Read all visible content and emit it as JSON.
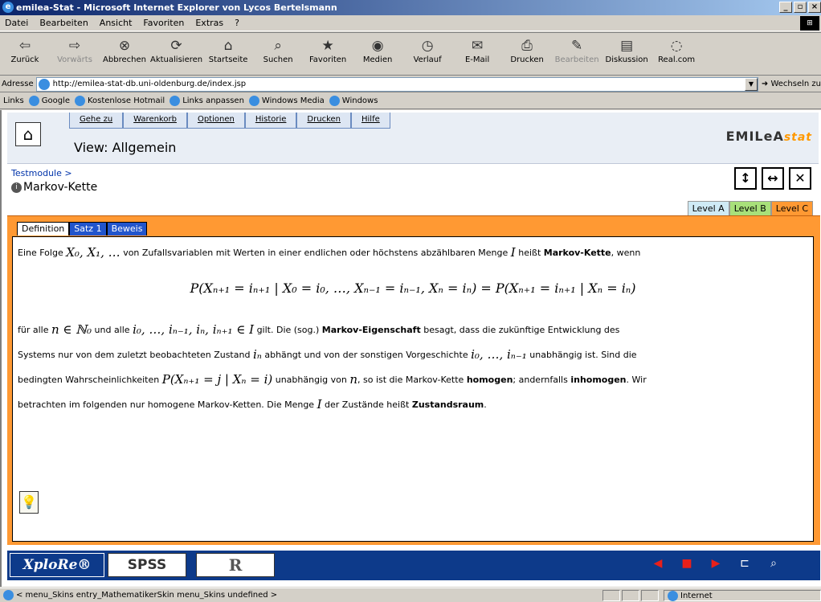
{
  "window": {
    "title": "emilea-Stat - Microsoft Internet Explorer von Lycos Bertelsmann"
  },
  "menu": [
    "Datei",
    "Bearbeiten",
    "Ansicht",
    "Favoriten",
    "Extras",
    "?"
  ],
  "toolbar": [
    {
      "label": "Zurück",
      "icon": "back-arrow-icon"
    },
    {
      "label": "Vorwärts",
      "icon": "forward-arrow-icon"
    },
    {
      "label": "Abbrechen",
      "icon": "stop-icon"
    },
    {
      "label": "Aktualisieren",
      "icon": "refresh-icon"
    },
    {
      "label": "Startseite",
      "icon": "home-icon"
    },
    {
      "label": "Suchen",
      "icon": "search-icon"
    },
    {
      "label": "Favoriten",
      "icon": "favorites-icon"
    },
    {
      "label": "Medien",
      "icon": "media-icon"
    },
    {
      "label": "Verlauf",
      "icon": "history-icon"
    },
    {
      "label": "E-Mail",
      "icon": "mail-icon"
    },
    {
      "label": "Drucken",
      "icon": "print-icon"
    },
    {
      "label": "Bearbeiten",
      "icon": "edit-icon"
    },
    {
      "label": "Diskussion",
      "icon": "discussion-icon"
    },
    {
      "label": "Real.com",
      "icon": "realcom-icon"
    }
  ],
  "address": {
    "label": "Adresse",
    "url": "http://emilea-stat-db.uni-oldenburg.de/index.jsp",
    "go": "Wechseln zu"
  },
  "links": {
    "label": "Links",
    "items": [
      "Google",
      "Kostenlose Hotmail",
      "Links anpassen",
      "Windows Media",
      "Windows"
    ]
  },
  "page": {
    "nav": [
      "Gehe zu",
      "Warenkorb",
      "Optionen",
      "Historie",
      "Drucken",
      "Hilfe"
    ],
    "view_title": "View: Allgemein",
    "brand": "EMILeA",
    "brand_suffix": "stat",
    "breadcrumb": "Testmodule >",
    "module_title": "Markov-Kette",
    "levels": [
      "Level A",
      "Level B",
      "Level C"
    ],
    "tabs": [
      "Definition",
      "Satz 1",
      "Beweis"
    ],
    "definition": {
      "p1_a": "Eine Folge",
      "p1_m1": "X₀, X₁, …",
      "p1_b": "von Zufallsvariablen mit Werten in einer endlichen oder höchstens abzählbaren Menge",
      "p1_m2": "I",
      "p1_c": "heißt",
      "p1_bold": "Markov-Kette",
      "p1_d": ", wenn",
      "formula": "P(Xₙ₊₁ = iₙ₊₁ | X₀ = i₀, …, Xₙ₋₁ = iₙ₋₁, Xₙ = iₙ) = P(Xₙ₊₁ = iₙ₊₁ | Xₙ = iₙ)",
      "l1_a": "für alle",
      "l1_m1": "n ∈ ℕ₀",
      "l1_b": "und alle",
      "l1_m2": "i₀, …, iₙ₋₁, iₙ, iₙ₊₁ ∈ I",
      "l1_c": "gilt. Die (sog.)",
      "l1_bold": "Markov-Eigenschaft",
      "l1_d": "besagt, dass die zukünftige Entwicklung des",
      "l2_a": "Systems nur von dem zuletzt beobachteten Zustand",
      "l2_m1": "iₙ",
      "l2_b": "abhängt und von der sonstigen Vorgeschichte",
      "l2_m2": "i₀, …, iₙ₋₁",
      "l2_c": "unabhängig ist. Sind die",
      "l3_a": "bedingten Wahrscheinlichkeiten",
      "l3_m1": "P(Xₙ₊₁ = j | Xₙ = i)",
      "l3_b": "unabhängig von",
      "l3_m2": "n",
      "l3_c": ", so ist die Markov-Kette",
      "l3_bold1": "homogen",
      "l3_d": "; andernfalls",
      "l3_bold2": "inhomogen",
      "l3_e": ". Wir",
      "l4_a": "betrachten im folgenden nur homogene Markov-Ketten. Die Menge",
      "l4_m1": "I",
      "l4_b": "der Zustände heißt",
      "l4_bold": "Zustandsraum",
      "l4_c": "."
    },
    "bottom_logos": [
      "XploRe®",
      "SPSS",
      "R"
    ]
  },
  "status": {
    "text": "< menu_Skins entry_MathematikerSkin menu_Skins undefined >",
    "zone": "Internet"
  }
}
